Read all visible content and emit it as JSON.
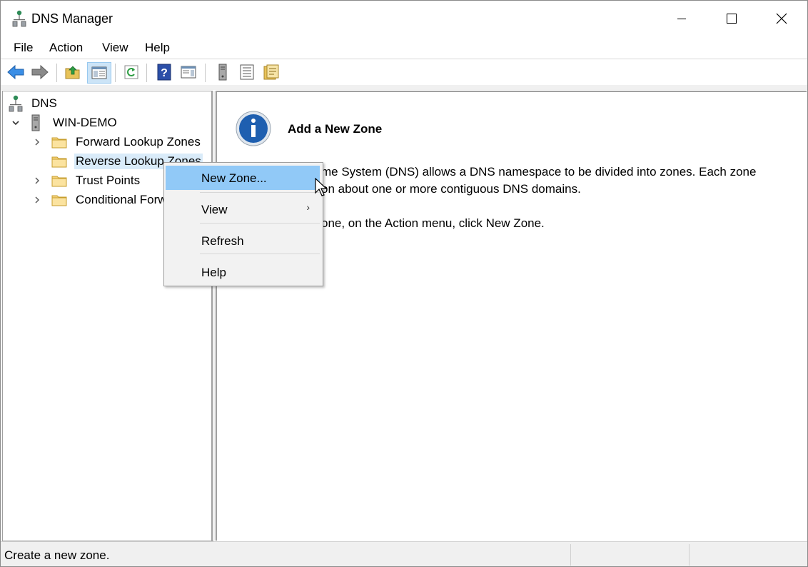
{
  "window": {
    "title": "DNS Manager",
    "controls": {
      "minimize": "minimize-icon",
      "maximize": "maximize-icon",
      "close": "close-icon"
    }
  },
  "menubar": {
    "items": [
      {
        "label": "File"
      },
      {
        "label": "Action"
      },
      {
        "label": "View"
      },
      {
        "label": "Help"
      }
    ]
  },
  "toolbar": {
    "buttons": [
      {
        "name": "back-icon"
      },
      {
        "name": "forward-icon"
      },
      {
        "name": "up-folder-icon"
      },
      {
        "name": "show-hide-console-tree-icon",
        "active": true
      },
      {
        "name": "refresh-icon"
      },
      {
        "name": "help-icon"
      },
      {
        "name": "show-hide-action-pane-icon"
      },
      {
        "name": "server-icon"
      },
      {
        "name": "list-icon"
      },
      {
        "name": "properties-icon"
      }
    ]
  },
  "tree": {
    "root": "DNS",
    "server": "WIN-DEMO",
    "items": [
      {
        "label": "Forward Lookup Zones"
      },
      {
        "label": "Reverse Lookup Zones",
        "selected": true
      },
      {
        "label": "Trust Points"
      },
      {
        "label": "Conditional Forw"
      }
    ]
  },
  "content": {
    "heading": "Add a New Zone",
    "line1": "me System (DNS) allows a DNS namespace to be divided into zones. Each zone",
    "line2": "on about one or more contiguous DNS domains.",
    "line3": "one, on the Action menu, click New Zone."
  },
  "context_menu": {
    "items": [
      {
        "label": "New Zone...",
        "highlighted": true
      },
      {
        "label": "View",
        "submenu": true
      },
      {
        "label": "Refresh"
      },
      {
        "label": "Help"
      }
    ]
  },
  "statusbar": {
    "text": "Create a new zone."
  },
  "colors": {
    "selection": "#d9ebf9",
    "menu_highlight": "#91c9f7",
    "info_blue": "#1e5fb0"
  }
}
